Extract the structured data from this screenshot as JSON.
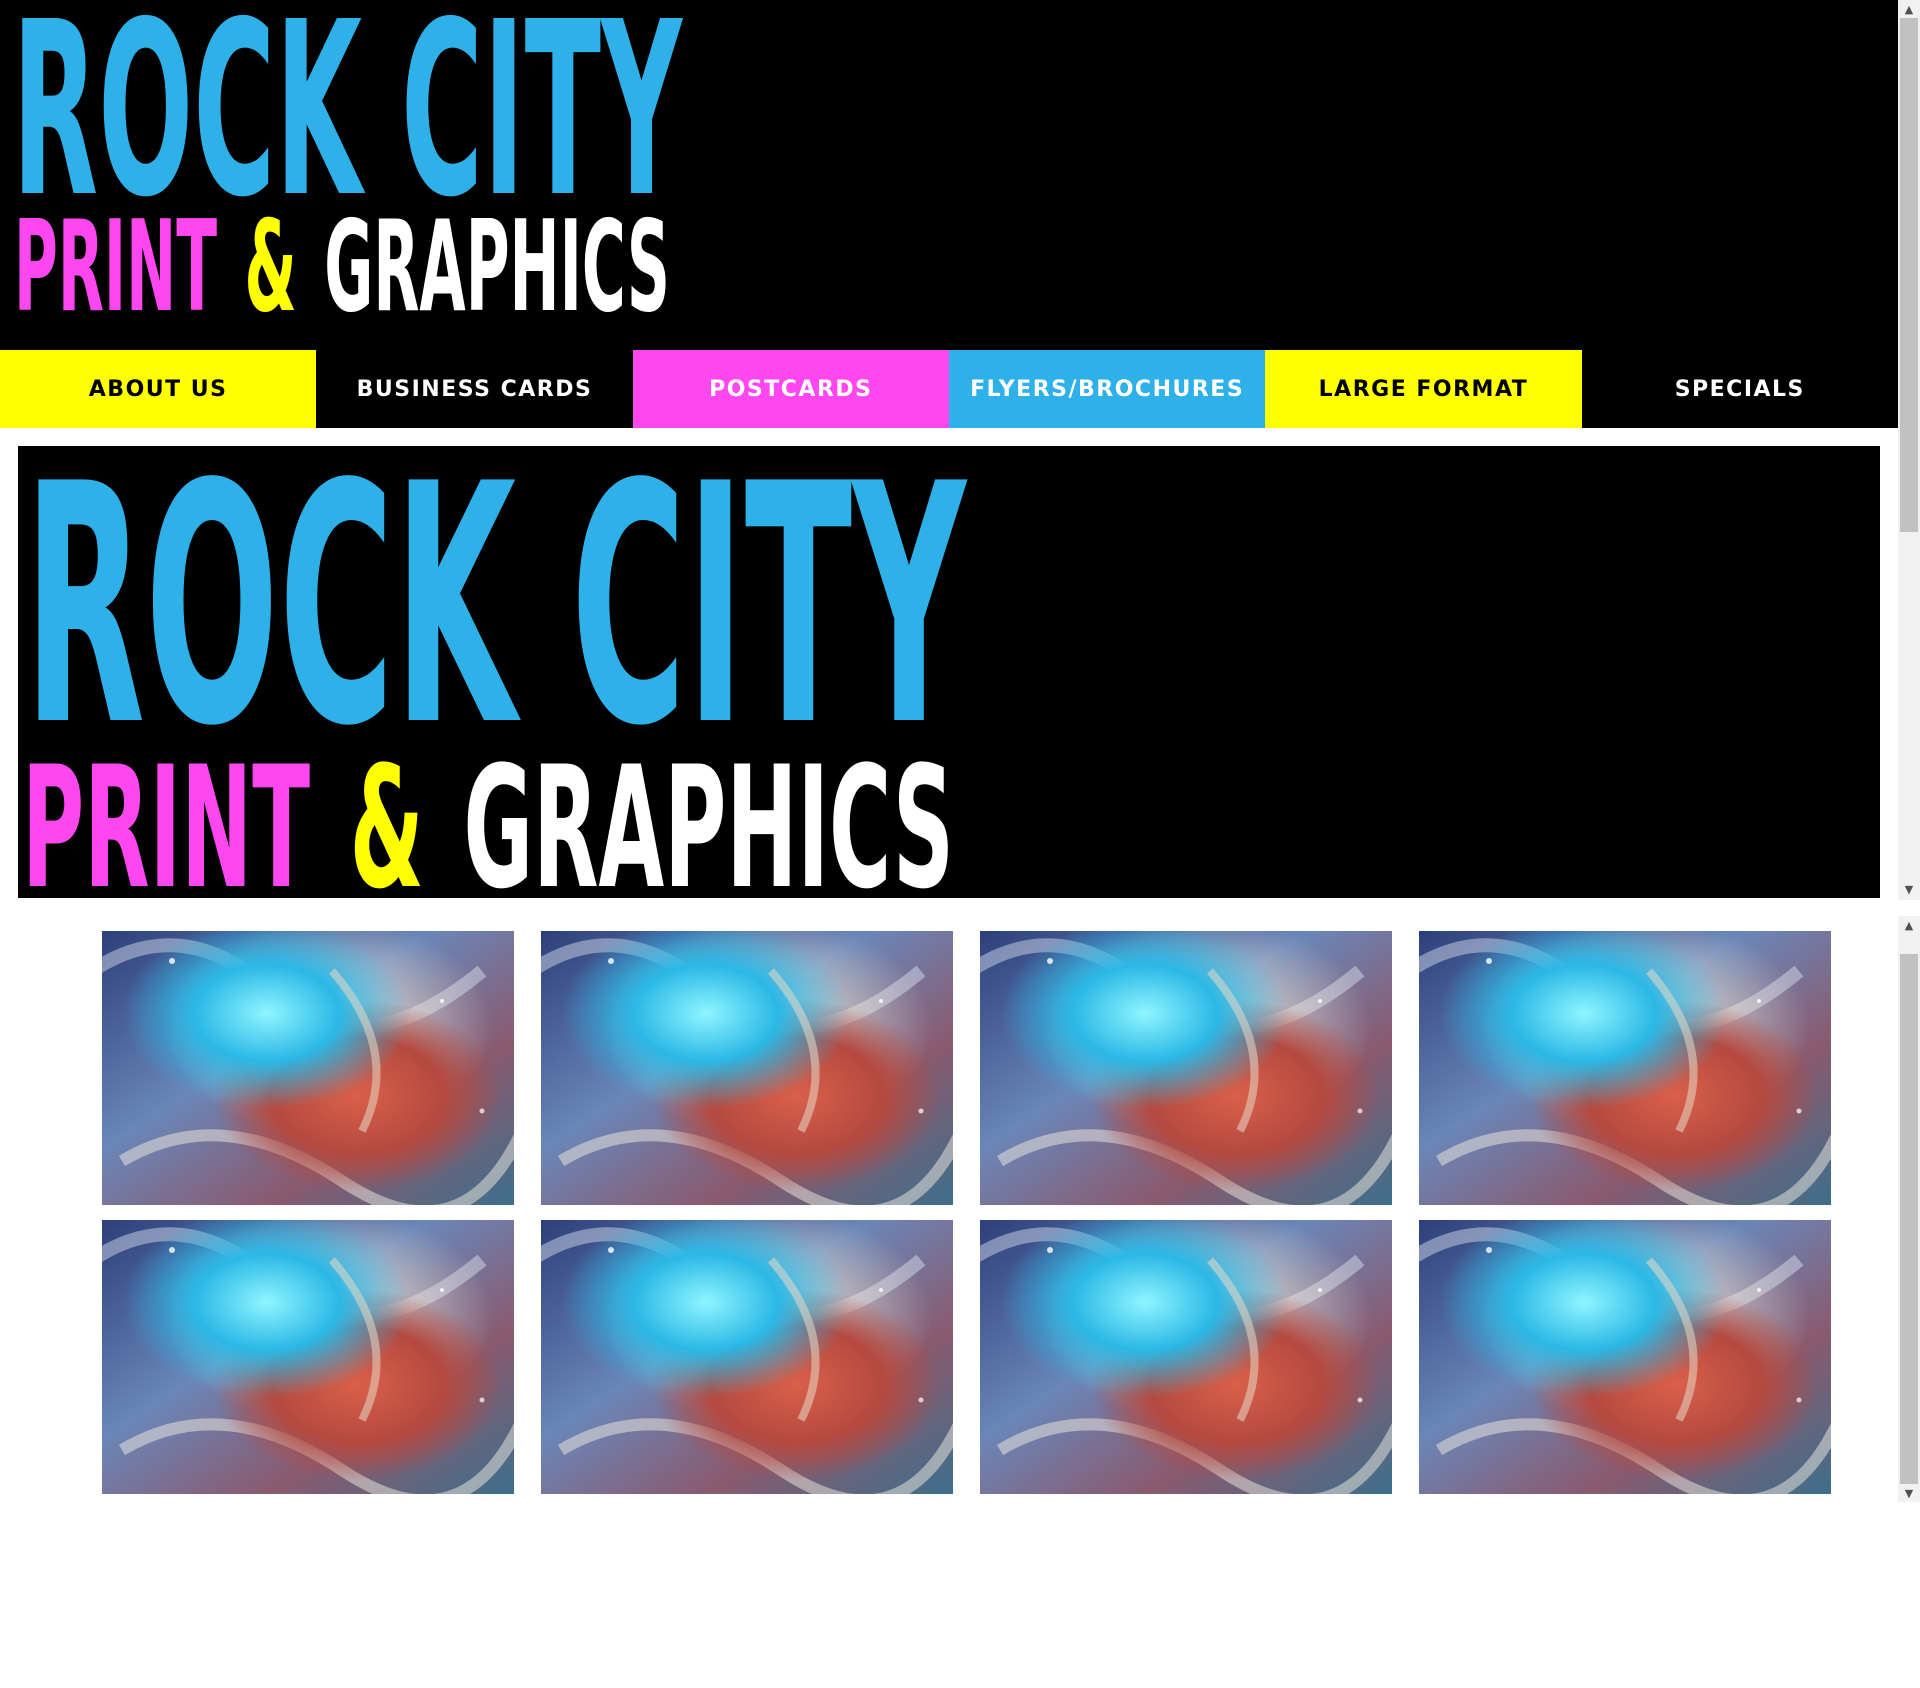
{
  "header": {
    "logo": {
      "line1": "ROCK CITY",
      "line2_word1": "PRINT",
      "line2_amp": "&",
      "line2_word2": "GRAPHICS"
    }
  },
  "nav": {
    "items": [
      {
        "label": "ABOUT US",
        "bg": "#ffff00",
        "color": "#000000"
      },
      {
        "label": "BUSINESS CARDS",
        "bg": "#000000",
        "color": "#ffffff"
      },
      {
        "label": "POSTCARDS",
        "bg": "#ff47f0",
        "color": "#ffffff"
      },
      {
        "label": "FLYERS/BROCHURES",
        "bg": "#2eb0e8",
        "color": "#ffffff"
      },
      {
        "label": "LARGE FORMAT",
        "bg": "#ffff00",
        "color": "#000000"
      },
      {
        "label": "SPECIALS",
        "bg": "#000000",
        "color": "#ffffff"
      }
    ]
  },
  "hero": {
    "logo": {
      "line1": "ROCK CITY",
      "line2_word1": "PRINT",
      "line2_amp": "&",
      "line2_word2": "GRAPHICS"
    }
  },
  "gallery": {
    "tile_image": "abstract-cosmic-art",
    "tile_count": 8
  },
  "colors": {
    "cyan": "#2eb0e8",
    "magenta": "#ff47f0",
    "yellow": "#ffff00",
    "white": "#ffffff",
    "black": "#000000"
  },
  "scrollbar": {
    "up_arrow": "▲",
    "down_arrow": "▼"
  }
}
